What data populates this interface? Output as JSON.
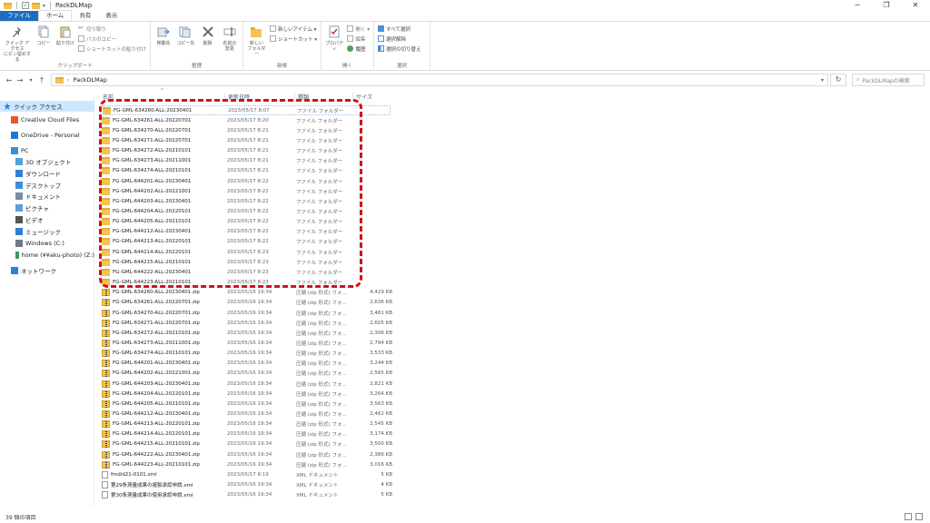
{
  "window": {
    "title": "PackDLMap",
    "controls": [
      "─",
      "❐",
      "✕"
    ]
  },
  "tabs": [
    {
      "label": "ファイル"
    },
    {
      "label": "ホーム"
    },
    {
      "label": "共有"
    },
    {
      "label": "表示"
    }
  ],
  "ribbon": {
    "clipboard": {
      "label": "クリップボード",
      "pin": "クイック アクセス\nにピン留めする",
      "copy": "コピー",
      "paste": "貼り付け",
      "cut": "切り取り",
      "copy_path": "パスのコピー",
      "paste_shortcut": "ショートカットの貼り付け"
    },
    "organize": {
      "label": "整理",
      "move_to": "移動先",
      "copy_to": "コピー先",
      "delete": "削除",
      "rename": "名前の\n変更"
    },
    "new": {
      "label": "新規",
      "new_folder": "新しい\nフォルダー",
      "new_item": "新しいアイテム ▾",
      "shortcut": "ショートカット ▾"
    },
    "open": {
      "label": "開く",
      "properties": "プロパティ",
      "open": "開く ▾",
      "edit": "編集",
      "history": "履歴"
    },
    "select": {
      "label": "選択",
      "select_all": "すべて選択",
      "select_none": "選択解除",
      "invert": "選択の切り替え"
    }
  },
  "address": {
    "path": "PackDLMap",
    "search_placeholder": "PackDLMapの検索"
  },
  "sidebar": [
    {
      "label": "クイック アクセス",
      "icon": "star-icon",
      "color": "#2f7fd8"
    },
    {
      "label": "Creative Cloud Files",
      "icon": "creative-cloud-icon",
      "color": "#e8562a"
    },
    {
      "label": "OneDrive - Personal",
      "icon": "onedrive-icon",
      "color": "#1f79d4"
    },
    {
      "label": "PC",
      "icon": "pc-icon",
      "color": "#3a8fd9"
    },
    {
      "label": "3D オブジェクト",
      "icon": "3d-objects-icon",
      "color": "#4aa3df"
    },
    {
      "label": "ダウンロード",
      "icon": "download-icon",
      "color": "#2f7fd8"
    },
    {
      "label": "デスクトップ",
      "icon": "desktop-icon",
      "color": "#3a8fd9"
    },
    {
      "label": "ドキュメント",
      "icon": "documents-icon",
      "color": "#7a8aa0"
    },
    {
      "label": "ピクチャ",
      "icon": "pictures-icon",
      "color": "#5a9fd9"
    },
    {
      "label": "ビデオ",
      "icon": "videos-icon",
      "color": "#555555"
    },
    {
      "label": "ミュージック",
      "icon": "music-icon",
      "color": "#2f7fd8"
    },
    {
      "label": "Windows (C:)",
      "icon": "drive-icon",
      "color": "#6a7a8a"
    },
    {
      "label": "home (¥¥aku-photo) (Z:)",
      "icon": "network-drive-icon",
      "color": "#3a9a5a"
    },
    {
      "label": "ネットワーク",
      "icon": "network-icon",
      "color": "#2f7fd8"
    }
  ],
  "columns": {
    "name": "名前",
    "date": "更新日時",
    "type": "種類",
    "size": "サイズ"
  },
  "files": [
    {
      "name": "FG-GML-634260-ALL-20230401",
      "date": "2023/05/17 8:07",
      "type": "ファイル フォルダー",
      "size": "",
      "kind": "folder"
    },
    {
      "name": "FG-GML-634261-ALL-20220701",
      "date": "2023/05/17 8:20",
      "type": "ファイル フォルダー",
      "size": "",
      "kind": "folder"
    },
    {
      "name": "FG-GML-634270-ALL-20220701",
      "date": "2023/05/17 8:21",
      "type": "ファイル フォルダー",
      "size": "",
      "kind": "folder"
    },
    {
      "name": "FG-GML-634271-ALL-20220701",
      "date": "2023/05/17 8:21",
      "type": "ファイル フォルダー",
      "size": "",
      "kind": "folder"
    },
    {
      "name": "FG-GML-634272-ALL-20210101",
      "date": "2023/05/17 8:21",
      "type": "ファイル フォルダー",
      "size": "",
      "kind": "folder"
    },
    {
      "name": "FG-GML-634273-ALL-20211001",
      "date": "2023/05/17 8:21",
      "type": "ファイル フォルダー",
      "size": "",
      "kind": "folder"
    },
    {
      "name": "FG-GML-634274-ALL-20210101",
      "date": "2023/05/17 8:21",
      "type": "ファイル フォルダー",
      "size": "",
      "kind": "folder"
    },
    {
      "name": "FG-GML-644201-ALL-20230401",
      "date": "2023/05/17 8:22",
      "type": "ファイル フォルダー",
      "size": "",
      "kind": "folder"
    },
    {
      "name": "FG-GML-644202-ALL-20221001",
      "date": "2023/05/17 8:22",
      "type": "ファイル フォルダー",
      "size": "",
      "kind": "folder"
    },
    {
      "name": "FG-GML-644203-ALL-20230401",
      "date": "2023/05/17 8:22",
      "type": "ファイル フォルダー",
      "size": "",
      "kind": "folder"
    },
    {
      "name": "FG-GML-644204-ALL-20220101",
      "date": "2023/05/17 8:22",
      "type": "ファイル フォルダー",
      "size": "",
      "kind": "folder"
    },
    {
      "name": "FG-GML-644205-ALL-20210101",
      "date": "2023/05/17 8:22",
      "type": "ファイル フォルダー",
      "size": "",
      "kind": "folder"
    },
    {
      "name": "FG-GML-644212-ALL-20230401",
      "date": "2023/05/17 8:22",
      "type": "ファイル フォルダー",
      "size": "",
      "kind": "folder"
    },
    {
      "name": "FG-GML-644213-ALL-20220101",
      "date": "2023/05/17 8:22",
      "type": "ファイル フォルダー",
      "size": "",
      "kind": "folder"
    },
    {
      "name": "FG-GML-644214-ALL-20220101",
      "date": "2023/05/17 8:23",
      "type": "ファイル フォルダー",
      "size": "",
      "kind": "folder"
    },
    {
      "name": "FG-GML-644215-ALL-20210101",
      "date": "2023/05/17 8:23",
      "type": "ファイル フォルダー",
      "size": "",
      "kind": "folder"
    },
    {
      "name": "FG-GML-644222-ALL-20230401",
      "date": "2023/05/17 8:23",
      "type": "ファイル フォルダー",
      "size": "",
      "kind": "folder"
    },
    {
      "name": "FG-GML-644223-ALL-20210101",
      "date": "2023/05/17 8:23",
      "type": "ファイル フォルダー",
      "size": "",
      "kind": "folder"
    },
    {
      "name": "FG-GML-634260-ALL-20230401.zip",
      "date": "2023/05/16 19:34",
      "type": "圧縮 (zip 形式) フォ...",
      "size": "4,429 KB",
      "kind": "zip"
    },
    {
      "name": "FG-GML-634261-ALL-20220701.zip",
      "date": "2023/05/16 19:34",
      "type": "圧縮 (zip 形式) フォ...",
      "size": "2,636 KB",
      "kind": "zip"
    },
    {
      "name": "FG-GML-634270-ALL-20220701.zip",
      "date": "2023/05/16 19:34",
      "type": "圧縮 (zip 形式) フォ...",
      "size": "3,481 KB",
      "kind": "zip"
    },
    {
      "name": "FG-GML-634271-ALL-20220701.zip",
      "date": "2023/05/16 19:34",
      "type": "圧縮 (zip 形式) フォ...",
      "size": "2,605 KB",
      "kind": "zip"
    },
    {
      "name": "FG-GML-634272-ALL-20210101.zip",
      "date": "2023/05/16 19:34",
      "type": "圧縮 (zip 形式) フォ...",
      "size": "2,306 KB",
      "kind": "zip"
    },
    {
      "name": "FG-GML-634273-ALL-20211001.zip",
      "date": "2023/05/16 19:34",
      "type": "圧縮 (zip 形式) フォ...",
      "size": "2,794 KB",
      "kind": "zip"
    },
    {
      "name": "FG-GML-634274-ALL-20210101.zip",
      "date": "2023/05/16 19:34",
      "type": "圧縮 (zip 形式) フォ...",
      "size": "3,533 KB",
      "kind": "zip"
    },
    {
      "name": "FG-GML-644201-ALL-20230401.zip",
      "date": "2023/05/16 19:34",
      "type": "圧縮 (zip 形式) フォ...",
      "size": "3,244 KB",
      "kind": "zip"
    },
    {
      "name": "FG-GML-644202-ALL-20221001.zip",
      "date": "2023/05/16 19:34",
      "type": "圧縮 (zip 形式) フォ...",
      "size": "2,565 KB",
      "kind": "zip"
    },
    {
      "name": "FG-GML-644203-ALL-20230401.zip",
      "date": "2023/05/16 19:34",
      "type": "圧縮 (zip 形式) フォ...",
      "size": "2,821 KB",
      "kind": "zip"
    },
    {
      "name": "FG-GML-644204-ALL-20220101.zip",
      "date": "2023/05/16 19:34",
      "type": "圧縮 (zip 形式) フォ...",
      "size": "3,264 KB",
      "kind": "zip"
    },
    {
      "name": "FG-GML-644205-ALL-20210101.zip",
      "date": "2023/05/16 19:34",
      "type": "圧縮 (zip 形式) フォ...",
      "size": "3,563 KB",
      "kind": "zip"
    },
    {
      "name": "FG-GML-644212-ALL-20230401.zip",
      "date": "2023/05/16 19:34",
      "type": "圧縮 (zip 形式) フォ...",
      "size": "2,462 KB",
      "kind": "zip"
    },
    {
      "name": "FG-GML-644213-ALL-20220101.zip",
      "date": "2023/05/16 19:34",
      "type": "圧縮 (zip 形式) フォ...",
      "size": "2,545 KB",
      "kind": "zip"
    },
    {
      "name": "FG-GML-644214-ALL-20220101.zip",
      "date": "2023/05/16 19:34",
      "type": "圧縮 (zip 形式) フォ...",
      "size": "3,174 KB",
      "kind": "zip"
    },
    {
      "name": "FG-GML-644215-ALL-20210101.zip",
      "date": "2023/05/16 19:34",
      "type": "圧縮 (zip 形式) フォ...",
      "size": "3,500 KB",
      "kind": "zip"
    },
    {
      "name": "FG-GML-644222-ALL-20230401.zip",
      "date": "2023/05/16 19:34",
      "type": "圧縮 (zip 形式) フォ...",
      "size": "2,386 KB",
      "kind": "zip"
    },
    {
      "name": "FG-GML-644223-ALL-20210101.zip",
      "date": "2023/05/16 19:34",
      "type": "圧縮 (zip 形式) フォ...",
      "size": "3,016 KB",
      "kind": "zip"
    },
    {
      "name": "fmdid21-0101.xml",
      "date": "2023/05/17 8:19",
      "type": "XML ドキュメント",
      "size": "5 KB",
      "kind": "xml"
    },
    {
      "name": "第29条測量成果の複製承認申請.xml",
      "date": "2023/05/16 19:34",
      "type": "XML ドキュメント",
      "size": "4 KB",
      "kind": "xml"
    },
    {
      "name": "第30条測量成果の使用承認申請.xml",
      "date": "2023/05/16 19:34",
      "type": "XML ドキュメント",
      "size": "5 KB",
      "kind": "xml"
    }
  ],
  "status": {
    "count": "39 個の項目"
  },
  "colors": {
    "accent": "#1d6dbf",
    "highlight": "#d0131b",
    "folder": "#f4c54c",
    "selection": "#cce8ff"
  }
}
